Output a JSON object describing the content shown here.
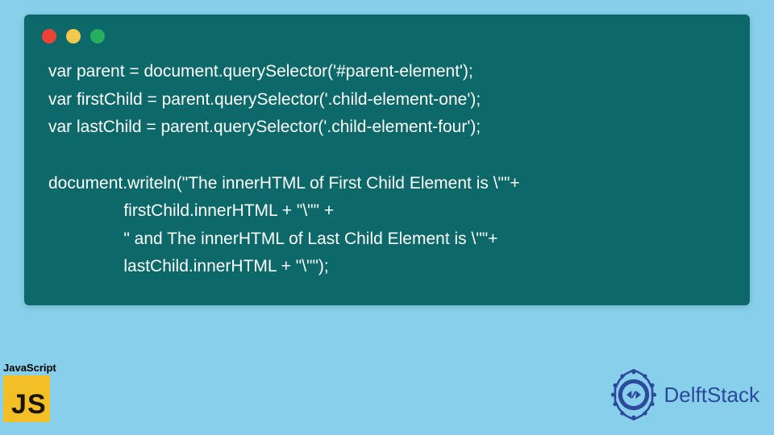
{
  "code": {
    "line1": "var parent = document.querySelector('#parent-element');",
    "line2": "var firstChild = parent.querySelector('.child-element-one');",
    "line3": "var lastChild = parent.querySelector('.child-element-four');",
    "line4": "",
    "line5": "document.writeln(\"The innerHTML of First Child Element is \\\"\"+",
    "line6": "                firstChild.innerHTML + \"\\\"\" +",
    "line7": "                \" and The innerHTML of Last Child Element is \\\"\"+",
    "line8": "                lastChild.innerHTML + \"\\\"\");"
  },
  "js_badge": {
    "label": "JavaScript",
    "icon_text": "JS"
  },
  "brand": {
    "name": "DelftStack"
  },
  "window_dots": {
    "red": "#ed4337",
    "yellow": "#f2c94c",
    "green": "#27ae60"
  }
}
